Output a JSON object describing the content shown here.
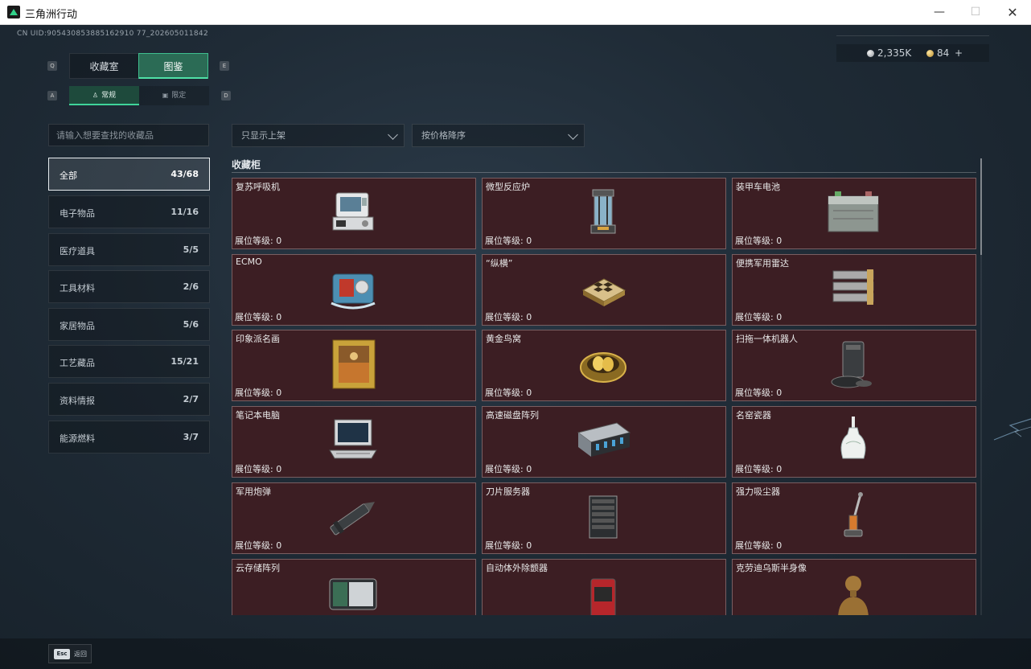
{
  "window": {
    "title": "三角洲行动",
    "min": "—",
    "max": "☐",
    "close": "✕"
  },
  "uid": "CN UID:905430853885162910 77_202605011842",
  "currency": {
    "silver": "2,335K",
    "gold": "84",
    "add": "+"
  },
  "keys": {
    "tab_left": "Q",
    "tab_right": "E",
    "sub_left": "A",
    "sub_right": "D"
  },
  "tabs": [
    {
      "label": "收藏室"
    },
    {
      "label": "图鉴"
    }
  ],
  "subtabs": [
    {
      "label": "常规",
      "icon": "trophy-icon"
    },
    {
      "label": "限定",
      "icon": "gift-icon"
    }
  ],
  "search": {
    "placeholder": "请输入想要查找的收藏品"
  },
  "filters": {
    "shelf": "只显示上架",
    "sort": "按价格降序"
  },
  "categories": [
    {
      "label": "全部",
      "count": "43/68"
    },
    {
      "label": "电子物品",
      "count": "11/16"
    },
    {
      "label": "医疗道具",
      "count": "5/5"
    },
    {
      "label": "工具材料",
      "count": "2/6"
    },
    {
      "label": "家居物品",
      "count": "5/6"
    },
    {
      "label": "工艺藏品",
      "count": "15/21"
    },
    {
      "label": "资料情报",
      "count": "2/7"
    },
    {
      "label": "能源燃料",
      "count": "3/7"
    }
  ],
  "section": {
    "title": "收藏柜"
  },
  "items": [
    {
      "name": "复苏呼吸机",
      "level": "展位等级: 0",
      "icon": "ventilator"
    },
    {
      "name": "微型反应炉",
      "level": "展位等级: 0",
      "icon": "reactor"
    },
    {
      "name": "装甲车电池",
      "level": "展位等级: 0",
      "icon": "battery"
    },
    {
      "name": "ECMO",
      "level": "展位等级: 0",
      "icon": "ecmo"
    },
    {
      "name": "“纵横”",
      "level": "展位等级: 0",
      "icon": "chessboard"
    },
    {
      "name": "便携军用雷达",
      "level": "展位等级: 0",
      "icon": "radar"
    },
    {
      "name": "印象派名画",
      "level": "展位等级: 0",
      "icon": "painting"
    },
    {
      "name": "黄金鸟窝",
      "level": "展位等级: 0",
      "icon": "golden-nest"
    },
    {
      "name": "扫拖一体机器人",
      "level": "展位等级: 0",
      "icon": "robot-vacuum"
    },
    {
      "name": "笔记本电脑",
      "level": "展位等级: 0",
      "icon": "laptop"
    },
    {
      "name": "高速磁盘阵列",
      "level": "展位等级: 0",
      "icon": "disk-array"
    },
    {
      "name": "名窑瓷器",
      "level": "展位等级: 0",
      "icon": "porcelain-vase"
    },
    {
      "name": "军用炮弹",
      "level": "展位等级: 0",
      "icon": "artillery-shell"
    },
    {
      "name": "刀片服务器",
      "level": "展位等级: 0",
      "icon": "blade-server"
    },
    {
      "name": "强力吸尘器",
      "level": "展位等级: 0",
      "icon": "vacuum-cleaner"
    },
    {
      "name": "云存储阵列",
      "level": "",
      "icon": "cloud-storage"
    },
    {
      "name": "自动体外除颤器",
      "level": "",
      "icon": "defibrillator"
    },
    {
      "name": "克劳迪乌斯半身像",
      "level": "",
      "icon": "bust-statue"
    }
  ],
  "footer": {
    "esc": "Esc",
    "back": "返回"
  }
}
